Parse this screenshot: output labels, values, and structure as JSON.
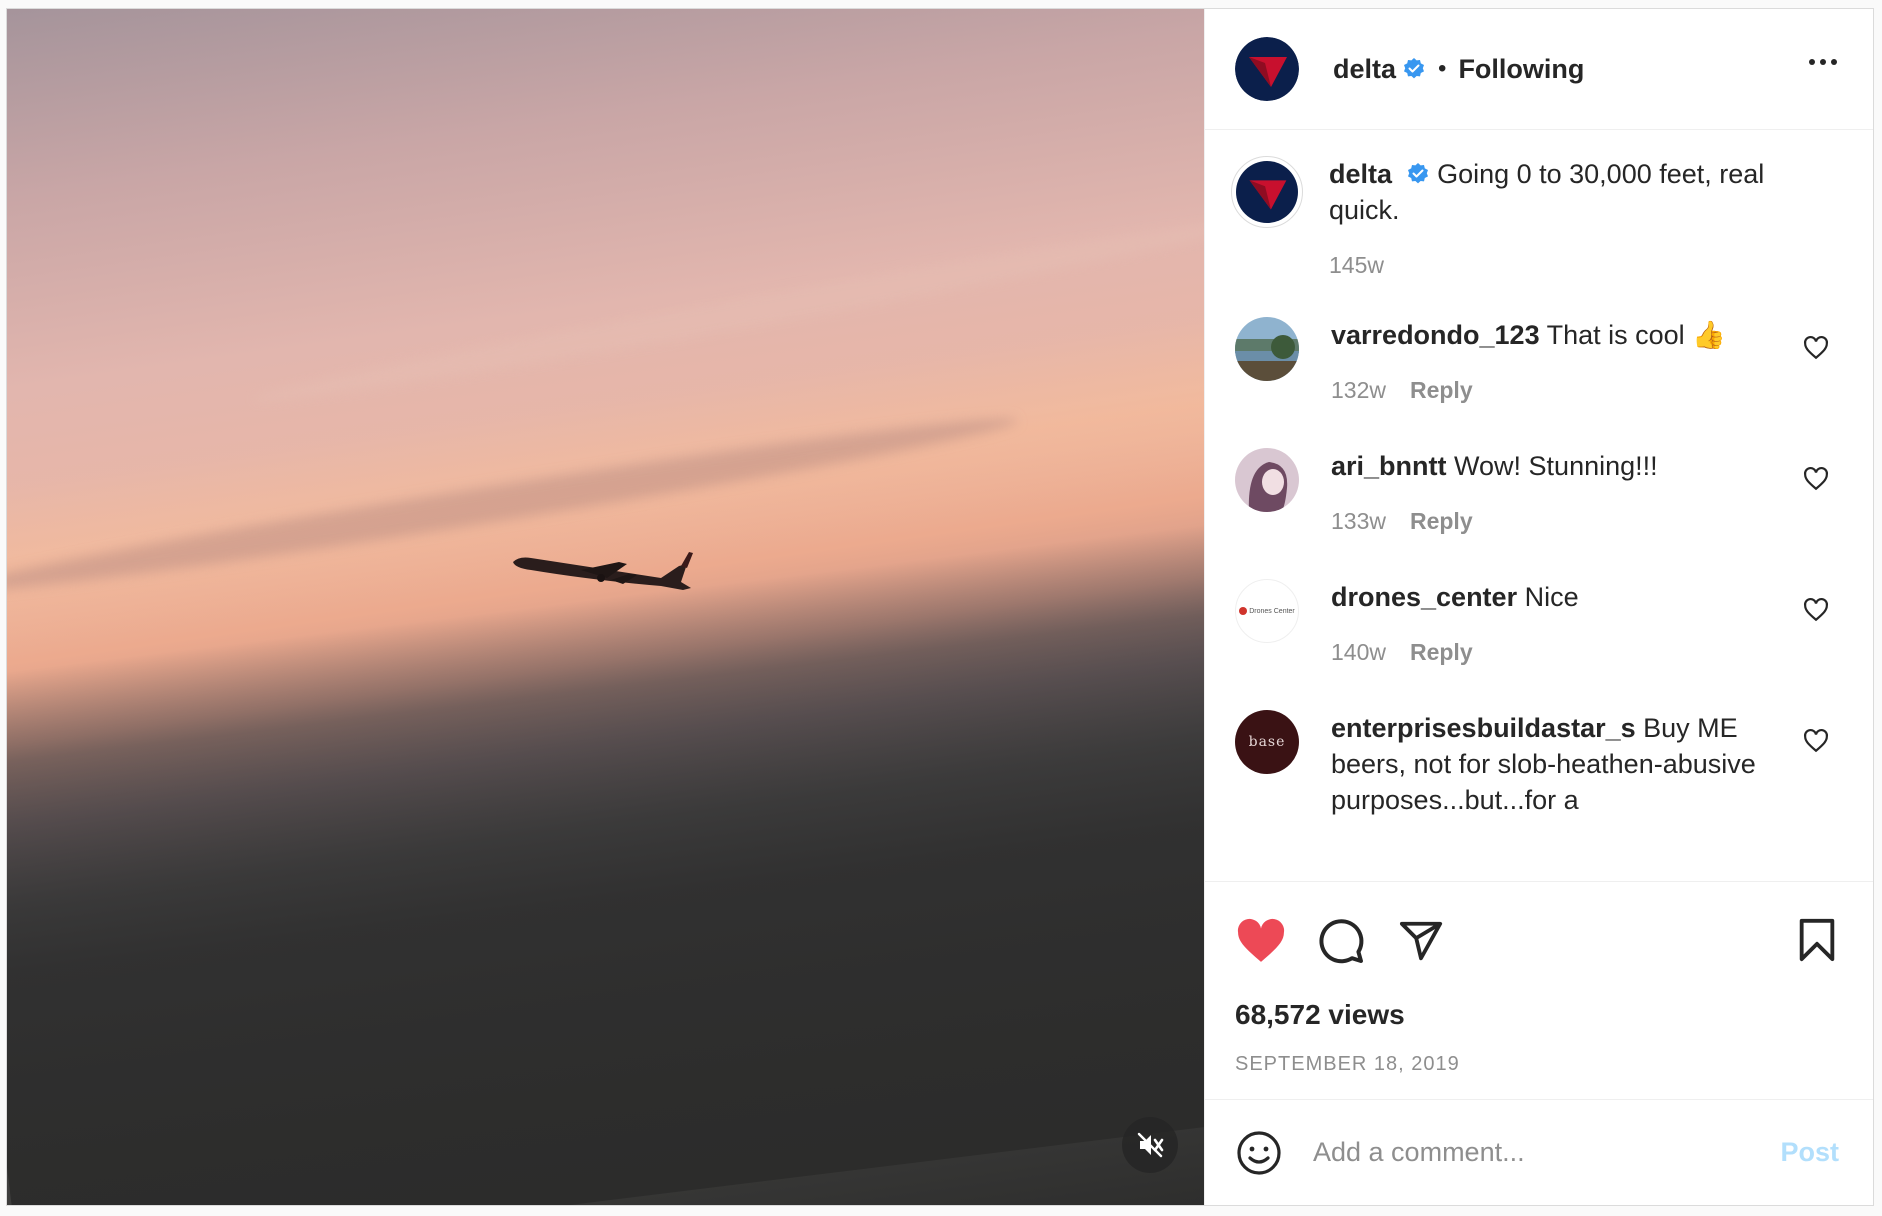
{
  "header": {
    "username": "delta",
    "separator": "•",
    "follow_label": "Following"
  },
  "caption": {
    "username": "delta",
    "text": "Going 0 to 30,000 feet, real quick.",
    "age": "145w"
  },
  "comments": [
    {
      "username": "varredondo_123",
      "text": "That is cool 👍",
      "age": "132w",
      "reply_label": "Reply"
    },
    {
      "username": "ari_bnntt",
      "text": "Wow! Stunning!!!",
      "age": "133w",
      "reply_label": "Reply"
    },
    {
      "username": "drones_center",
      "text": "Nice",
      "age": "140w",
      "reply_label": "Reply"
    },
    {
      "username": "enterprisesbuildastar_s",
      "text": "Buy ME beers, not for slob-heathen-abusive purposes...but...for a",
      "age": "",
      "reply_label": ""
    }
  ],
  "avatar_text": {
    "drones_center": "Drones Center",
    "enterprisesbuildastar_s": "base"
  },
  "stats": {
    "views": "68,572 views",
    "date": "SEPTEMBER 18, 2019"
  },
  "add_comment": {
    "placeholder": "Add a comment...",
    "post_label": "Post"
  },
  "icons": {
    "like": "heart-filled-icon",
    "comment": "comment-bubble-icon",
    "share": "paper-plane-icon",
    "save": "bookmark-icon",
    "emoji": "emoji-smiley-icon",
    "mute": "speaker-muted-icon",
    "more": "more-options-icon"
  },
  "colors": {
    "like_red": "#ed4956",
    "verified_blue": "#3897f0",
    "post_disabled": "#b2dffc",
    "delta_red": "#c8102e",
    "delta_navy": "#0b1f4b"
  }
}
